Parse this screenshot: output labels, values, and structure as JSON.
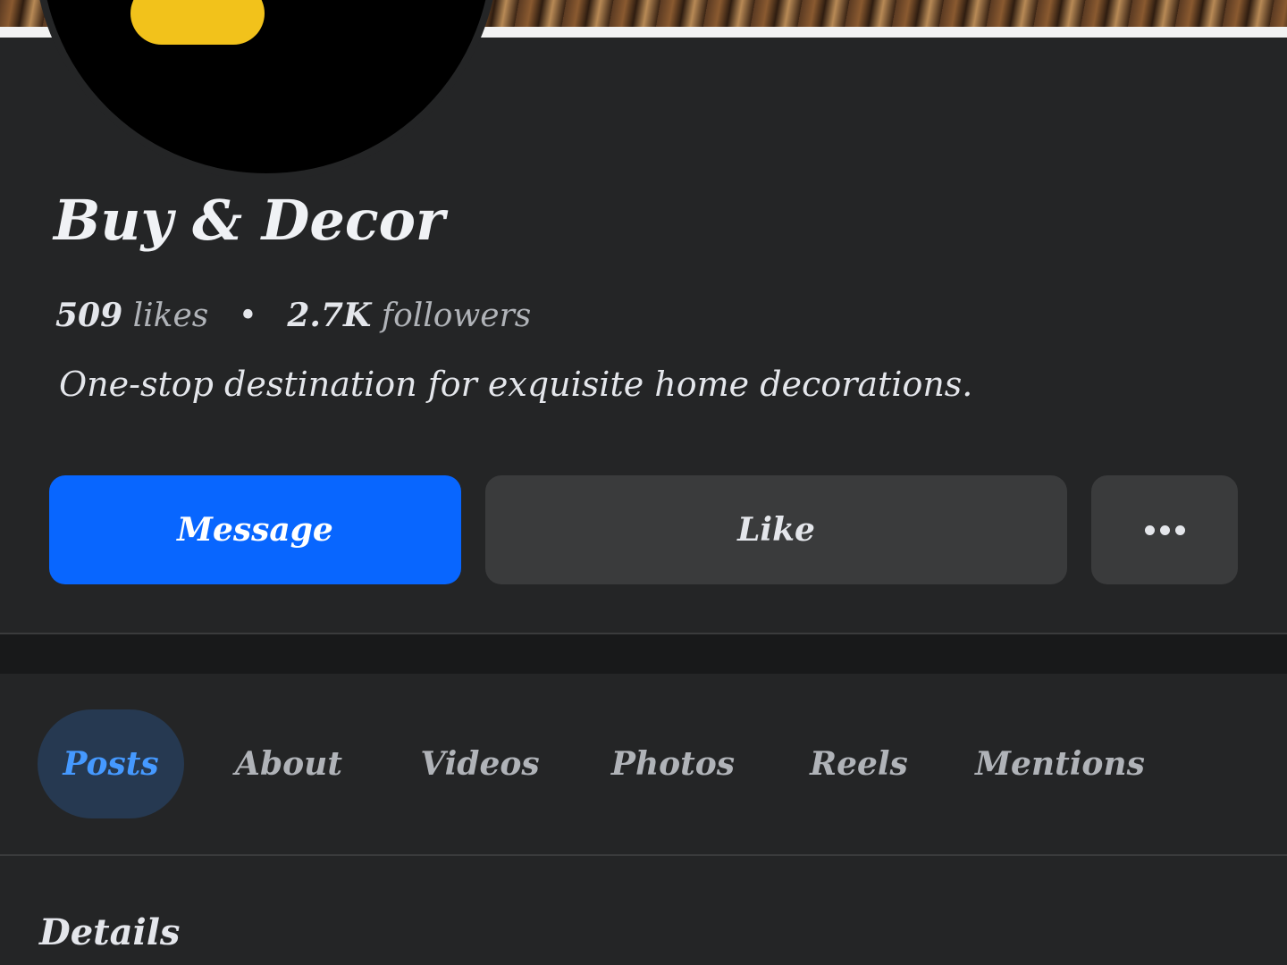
{
  "page": {
    "name": "Buy & Decor",
    "likes_count": "509",
    "likes_label": "likes",
    "followers_count": "2.7K",
    "followers_label": "followers",
    "separator": "•",
    "bio": "One-stop destination for exquisite home decorations."
  },
  "actions": {
    "message_label": "Message",
    "like_label": "Like",
    "more_icon": "more-horizontal-icon"
  },
  "tabs": [
    {
      "label": "Posts",
      "active": true
    },
    {
      "label": "About",
      "active": false
    },
    {
      "label": "Videos",
      "active": false
    },
    {
      "label": "Photos",
      "active": false
    },
    {
      "label": "Reels",
      "active": false
    },
    {
      "label": "Mentions",
      "active": false
    }
  ],
  "details": {
    "title": "Details"
  },
  "colors": {
    "background": "#242526",
    "primary_button": "#0866ff",
    "secondary_button": "#3a3b3c",
    "active_tab_bg": "#263951",
    "active_tab_text": "#4599ff"
  }
}
